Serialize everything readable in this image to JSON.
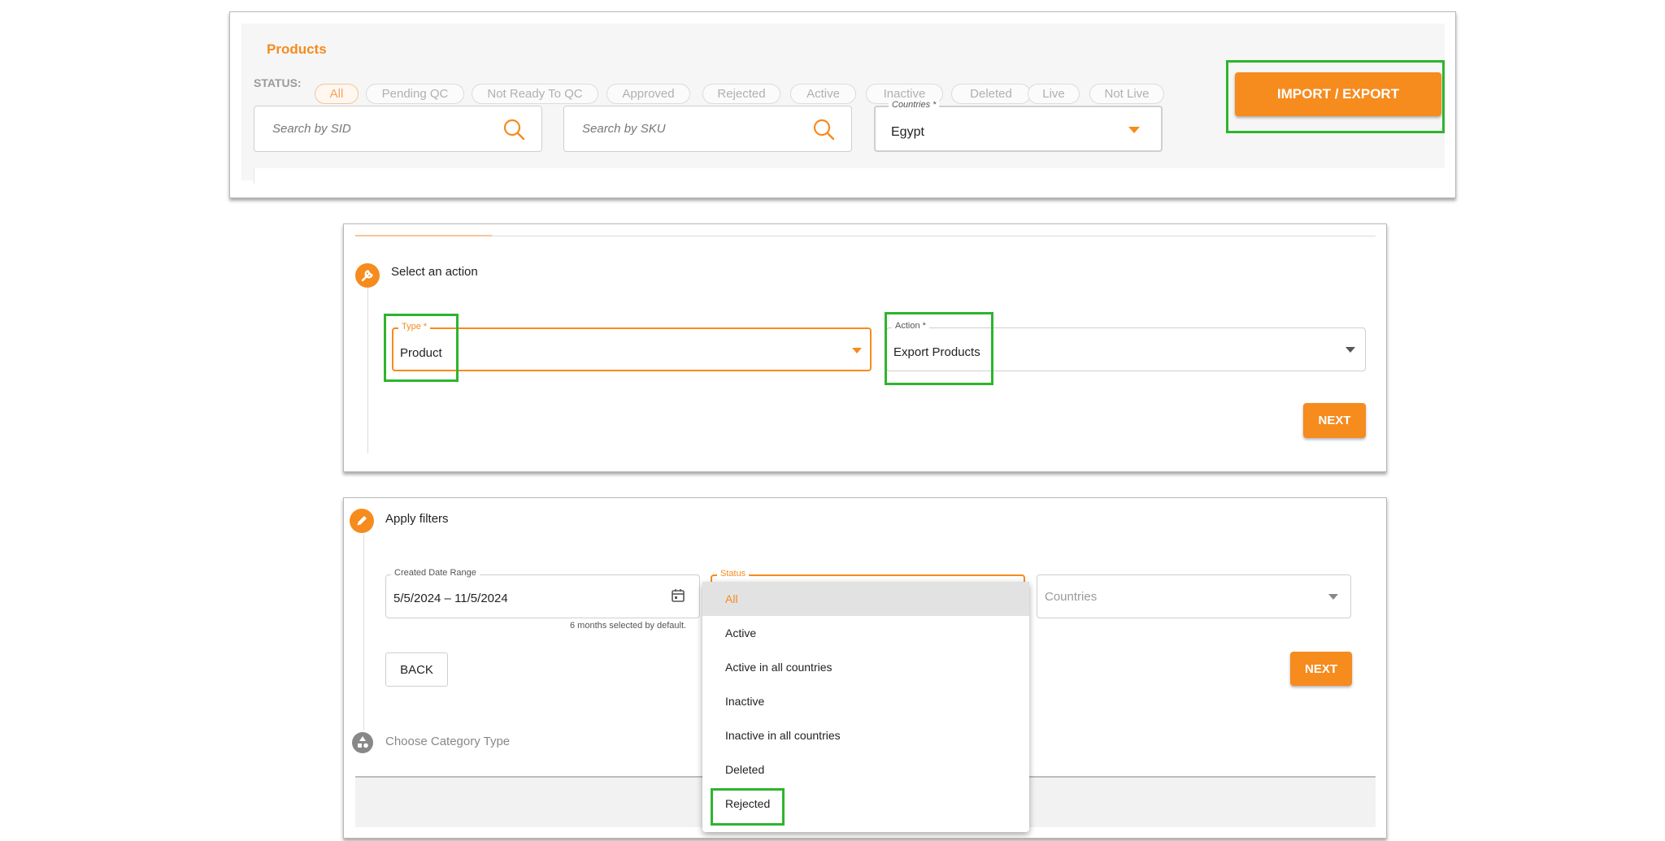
{
  "panel1": {
    "title": "Products",
    "status_label": "STATUS:",
    "chips": [
      "All",
      "Pending QC",
      "Not Ready To QC",
      "Approved",
      "Rejected",
      "Active",
      "Inactive",
      "Deleted",
      "Live",
      "Not Live"
    ],
    "active_chip": "All",
    "search_sid_placeholder": "Search by SID",
    "search_sku_placeholder": "Search by SKU",
    "countries_label": "Countries *",
    "countries_value": "Egypt",
    "import_export_label": "IMPORT / EXPORT"
  },
  "panel2": {
    "step_title": "Select an action",
    "type_label": "Type *",
    "type_value": "Product",
    "action_label": "Action *",
    "action_value": "Export Products",
    "next_label": "NEXT"
  },
  "panel3": {
    "step_title": "Apply filters",
    "date_range_label": "Created Date Range",
    "date_range_value": "5/5/2024 – 11/5/2024",
    "date_helper": "6 months selected by default.",
    "status_label": "Status",
    "countries_placeholder": "Countries",
    "back_label": "BACK",
    "next_label": "NEXT",
    "next_step_title": "Choose Category Type",
    "status_options": [
      "All",
      "Active",
      "Active in all countries",
      "Inactive",
      "Inactive in all countries",
      "Deleted",
      "Rejected"
    ],
    "selected_option": "All"
  },
  "colors": {
    "accent": "#f68b1e",
    "highlight": "#2db52d"
  },
  "icons": {
    "search": "search-icon",
    "dropdown": "caret-down-icon",
    "step_action": "wrench-icon",
    "step_filters": "pencil-icon",
    "step_category": "shapes-icon",
    "calendar": "calendar-icon"
  }
}
